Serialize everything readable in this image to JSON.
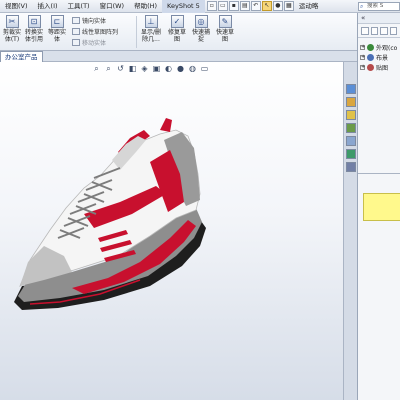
{
  "menubar": {
    "items": [
      "视图(V)",
      "插入(I)",
      "工具(T)",
      "窗口(W)",
      "帮助(H)",
      "KeyShot 5"
    ],
    "run_label": "运动略",
    "search_placeholder": "搜索 S"
  },
  "ribbon": {
    "buttons": [
      {
        "label": "剪裁实体(T)",
        "icon": "trim-icon"
      },
      {
        "label": "转换实体引用",
        "icon": "convert-entities-icon"
      },
      {
        "label": "等距实体",
        "icon": "offset-entities-icon"
      },
      {
        "label": "显示/删除几...",
        "icon": "display-delete-relations-icon"
      },
      {
        "label": "修复草图",
        "icon": "repair-sketch-icon"
      },
      {
        "label": "快速捕捉",
        "icon": "quick-snaps-icon"
      },
      {
        "label": "快速草图",
        "icon": "rapid-sketch-icon"
      }
    ],
    "small_items": [
      {
        "label": "镜向实体",
        "enabled": true
      },
      {
        "label": "线性草图阵列",
        "enabled": true
      },
      {
        "label": "移动实体",
        "enabled": false
      }
    ]
  },
  "tabs": {
    "active": "办公室产品"
  },
  "panel": {
    "tree": [
      {
        "label": "外观(co",
        "color": "#3a8a3a"
      },
      {
        "label": "布景",
        "color": "#4a6fb5"
      },
      {
        "label": "贴图",
        "color": "#b54a4a"
      }
    ]
  },
  "colors": {
    "accent": "#c8102e",
    "viewport_bg": "#f3f5f9",
    "note_yellow": "#fff98c"
  }
}
